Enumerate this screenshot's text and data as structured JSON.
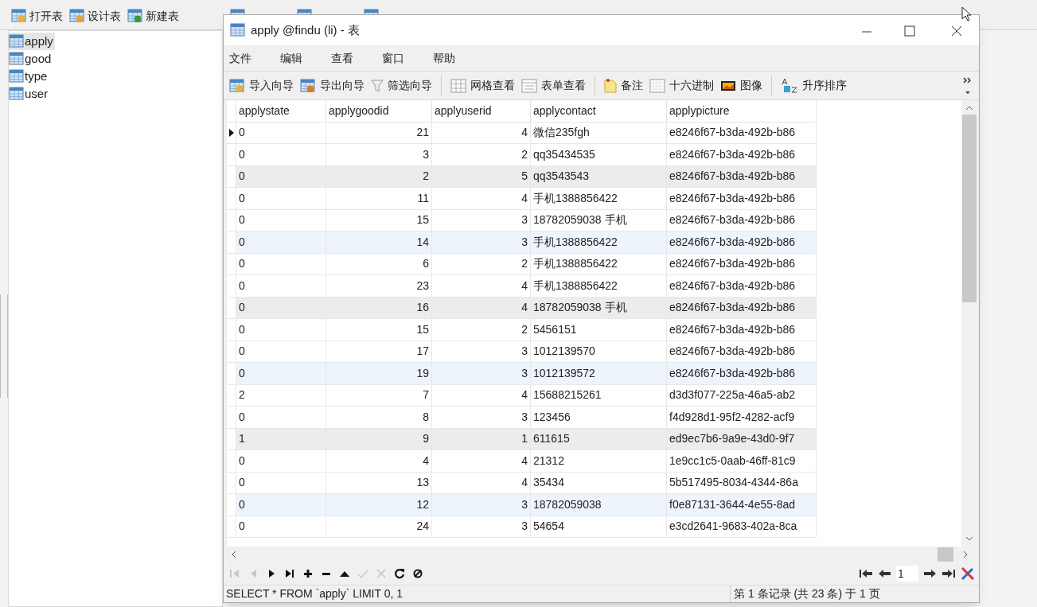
{
  "app_toolbar": [
    {
      "label": "打开表",
      "kind": "open"
    },
    {
      "label": "设计表",
      "kind": "design"
    },
    {
      "label": "新建表",
      "kind": "new"
    }
  ],
  "tables": [
    {
      "label": "apply",
      "selected": true
    },
    {
      "label": "good",
      "selected": false
    },
    {
      "label": "type",
      "selected": false
    },
    {
      "label": "user",
      "selected": false
    }
  ],
  "window": {
    "title": "apply @findu (li) - 表"
  },
  "menu": [
    "文件",
    "编辑",
    "查看",
    "窗口",
    "帮助"
  ],
  "toolbar": [
    {
      "kind": "import",
      "label": "导入向导"
    },
    {
      "kind": "export",
      "label": "导出向导"
    },
    {
      "kind": "filter",
      "label": "筛选向导"
    },
    {
      "kind": "separator"
    },
    {
      "kind": "grid",
      "label": "网格查看"
    },
    {
      "kind": "form",
      "label": "表单查看"
    },
    {
      "kind": "separator"
    },
    {
      "kind": "note",
      "label": "备注"
    },
    {
      "kind": "hex",
      "label": "十六进制"
    },
    {
      "kind": "image",
      "label": "图像"
    },
    {
      "kind": "separator"
    },
    {
      "kind": "sort",
      "label": "升序排序"
    }
  ],
  "grid": {
    "columns": [
      "applystate",
      "applygoodid",
      "applyuserid",
      "applycontact",
      "applypicture"
    ],
    "rows": [
      {
        "cells": [
          "0",
          "21",
          "4",
          "微信235fgh",
          "e8246f67-b3da-492b-b86"
        ],
        "current": true,
        "color": "#ffffff"
      },
      {
        "cells": [
          "0",
          "3",
          "2",
          "qq35434535",
          "e8246f67-b3da-492b-b86"
        ],
        "current": false,
        "color": "#ffffff"
      },
      {
        "cells": [
          "0",
          "2",
          "5",
          "qq3543543",
          "e8246f67-b3da-492b-b86"
        ],
        "current": false,
        "color": "#ececec"
      },
      {
        "cells": [
          "0",
          "11",
          "4",
          "手机1388856422",
          "e8246f67-b3da-492b-b86"
        ],
        "current": false,
        "color": "#ffffff"
      },
      {
        "cells": [
          "0",
          "15",
          "3",
          "18782059038 手机",
          "e8246f67-b3da-492b-b86"
        ],
        "current": false,
        "color": "#ffffff"
      },
      {
        "cells": [
          "0",
          "14",
          "3",
          "手机1388856422",
          "e8246f67-b3da-492b-b86"
        ],
        "current": false,
        "color": "#eef4fc"
      },
      {
        "cells": [
          "0",
          "6",
          "2",
          "手机1388856422",
          "e8246f67-b3da-492b-b86"
        ],
        "current": false,
        "color": "#ffffff"
      },
      {
        "cells": [
          "0",
          "23",
          "4",
          "手机1388856422",
          "e8246f67-b3da-492b-b86"
        ],
        "current": false,
        "color": "#ffffff"
      },
      {
        "cells": [
          "0",
          "16",
          "4",
          "18782059038 手机",
          "e8246f67-b3da-492b-b86"
        ],
        "current": false,
        "color": "#ececec"
      },
      {
        "cells": [
          "0",
          "15",
          "2",
          "5456151",
          "e8246f67-b3da-492b-b86"
        ],
        "current": false,
        "color": "#ffffff"
      },
      {
        "cells": [
          "0",
          "17",
          "3",
          "1012139570",
          "e8246f67-b3da-492b-b86"
        ],
        "current": false,
        "color": "#ffffff"
      },
      {
        "cells": [
          "0",
          "19",
          "3",
          "1012139572",
          "e8246f67-b3da-492b-b86"
        ],
        "current": false,
        "color": "#eef4fc"
      },
      {
        "cells": [
          "2",
          "7",
          "4",
          "15688215261",
          "d3d3f077-225a-46a5-ab2"
        ],
        "current": false,
        "color": "#ffffff"
      },
      {
        "cells": [
          "0",
          "8",
          "3",
          "123456",
          "f4d928d1-95f2-4282-acf9"
        ],
        "current": false,
        "color": "#ffffff"
      },
      {
        "cells": [
          "1",
          "9",
          "1",
          "611615",
          "ed9ec7b6-9a9e-43d0-9f7"
        ],
        "current": false,
        "color": "#ececec"
      },
      {
        "cells": [
          "0",
          "4",
          "4",
          "21312",
          "1e9cc1c5-0aab-46ff-81c9"
        ],
        "current": false,
        "color": "#ffffff"
      },
      {
        "cells": [
          "0",
          "13",
          "4",
          "35434",
          "5b517495-8034-4344-86a"
        ],
        "current": false,
        "color": "#ffffff"
      },
      {
        "cells": [
          "0",
          "12",
          "3",
          "18782059038",
          "f0e87131-3644-4e55-8ad"
        ],
        "current": false,
        "color": "#eef4fc"
      },
      {
        "cells": [
          "0",
          "24",
          "3",
          "54654",
          "e3cd2641-9683-402a-8ca"
        ],
        "current": false,
        "color": "#ffffff"
      }
    ]
  },
  "nav_buttons": [
    {
      "kind": "first",
      "disabled": true
    },
    {
      "kind": "prev",
      "disabled": true
    },
    {
      "kind": "next",
      "disabled": false
    },
    {
      "kind": "last",
      "disabled": false
    },
    {
      "kind": "add",
      "disabled": false
    },
    {
      "kind": "delete",
      "disabled": false
    },
    {
      "kind": "up",
      "disabled": false
    },
    {
      "kind": "apply",
      "disabled": true
    },
    {
      "kind": "cancel",
      "disabled": true
    },
    {
      "kind": "refresh",
      "disabled": false
    },
    {
      "kind": "stop",
      "disabled": false
    }
  ],
  "pager": {
    "page": "1"
  },
  "status_bar": {
    "query": "SELECT * FROM `apply` LIMIT 0, 1",
    "record": "第 1 条记录 (共 23 条) 于 1 页"
  }
}
